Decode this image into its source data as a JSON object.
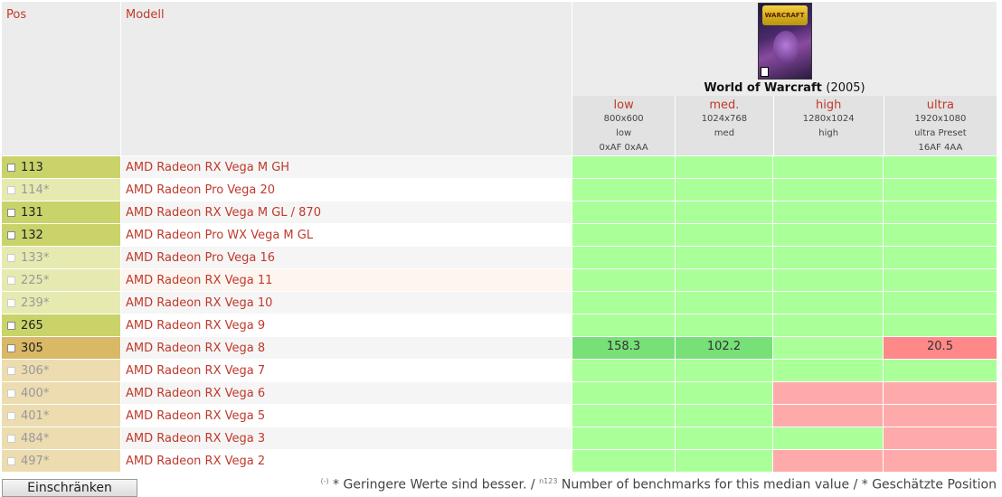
{
  "header": {
    "pos_label": "Pos",
    "model_label": "Modell",
    "game": {
      "name": "World of Warcraft",
      "year": "(2005)",
      "cover_logo": "WARCRAFT"
    },
    "settings": [
      {
        "level": "low",
        "res": "800x600",
        "preset": "low",
        "extra": "0xAF 0xAA",
        "width": 114
      },
      {
        "level": "med.",
        "res": "1024x768",
        "preset": "med",
        "extra": "",
        "width": 108
      },
      {
        "level": "high",
        "res": "1280x1024",
        "preset": "high",
        "extra": "",
        "width": 122
      },
      {
        "level": "ultra",
        "res": "1920x1080",
        "preset": "ultra Preset",
        "extra": "16AF 4AA",
        "width": 125
      }
    ]
  },
  "colors": {
    "pos_dark": "#c9d36a",
    "pos_light": "#e6eab0",
    "pos_gold": "#d9b866",
    "pos_gold_light": "#ecdcb0",
    "green": "#aaff99",
    "dark_green": "#77e077",
    "red": "#ffaaaa",
    "dark_red": "#ff8888",
    "row_alt": "#f5f5f5",
    "row_highlight": "#fdf5ef"
  },
  "rows": [
    {
      "pos": "113",
      "est": false,
      "model": "AMD Radeon RX Vega M GH",
      "cells": [
        "green",
        "green",
        "green",
        "green"
      ],
      "values": [
        "",
        "",
        "",
        ""
      ]
    },
    {
      "pos": "114*",
      "est": true,
      "model": "AMD Radeon Pro Vega 20",
      "cells": [
        "green",
        "green",
        "green",
        "green"
      ],
      "values": [
        "",
        "",
        "",
        ""
      ]
    },
    {
      "pos": "131",
      "est": false,
      "model": "AMD Radeon RX Vega M GL / 870",
      "cells": [
        "green",
        "green",
        "green",
        "green"
      ],
      "values": [
        "",
        "",
        "",
        ""
      ]
    },
    {
      "pos": "132",
      "est": false,
      "model": "AMD Radeon Pro WX Vega M GL",
      "cells": [
        "green",
        "green",
        "green",
        "green"
      ],
      "values": [
        "",
        "",
        "",
        ""
      ]
    },
    {
      "pos": "133*",
      "est": true,
      "model": "AMD Radeon Pro Vega 16",
      "cells": [
        "green",
        "green",
        "green",
        "green"
      ],
      "values": [
        "",
        "",
        "",
        ""
      ]
    },
    {
      "pos": "225*",
      "est": true,
      "model": "AMD Radeon RX Vega 11",
      "cells": [
        "green",
        "green",
        "green",
        "green"
      ],
      "values": [
        "",
        "",
        "",
        ""
      ]
    },
    {
      "pos": "239*",
      "est": true,
      "model": "AMD Radeon RX Vega 10",
      "cells": [
        "green",
        "green",
        "green",
        "green"
      ],
      "values": [
        "",
        "",
        "",
        ""
      ]
    },
    {
      "pos": "265",
      "est": false,
      "model": "AMD Radeon RX Vega 9",
      "cells": [
        "green",
        "green",
        "green",
        "green"
      ],
      "values": [
        "",
        "",
        "",
        ""
      ]
    },
    {
      "pos": "305",
      "est": false,
      "model": "AMD Radeon RX Vega 8",
      "cells": [
        "dgreen",
        "dgreen",
        "green",
        "dred"
      ],
      "values": [
        "158.3",
        "102.2",
        "",
        "20.5"
      ]
    },
    {
      "pos": "306*",
      "est": true,
      "model": "AMD Radeon RX Vega 7",
      "cells": [
        "green",
        "green",
        "green",
        "green"
      ],
      "values": [
        "",
        "",
        "",
        ""
      ]
    },
    {
      "pos": "400*",
      "est": true,
      "model": "AMD Radeon RX Vega 6",
      "cells": [
        "green",
        "green",
        "red",
        "red"
      ],
      "values": [
        "",
        "",
        "",
        ""
      ]
    },
    {
      "pos": "401*",
      "est": true,
      "model": "AMD Radeon RX Vega 5",
      "cells": [
        "green",
        "green",
        "red",
        "red"
      ],
      "values": [
        "",
        "",
        "",
        ""
      ]
    },
    {
      "pos": "484*",
      "est": true,
      "model": "AMD Radeon RX Vega 3",
      "cells": [
        "green",
        "green",
        "green",
        "red"
      ],
      "values": [
        "",
        "",
        "",
        ""
      ]
    },
    {
      "pos": "497*",
      "est": true,
      "model": "AMD Radeon RX Vega 2",
      "cells": [
        "green",
        "green",
        "red",
        "red"
      ],
      "values": [
        "",
        "",
        "",
        ""
      ]
    }
  ],
  "footer": {
    "button_label": "Einschränken",
    "note_sup1": "(-)",
    "note_text1": " * Geringere Werte sind besser. / ",
    "note_sup2": "n123",
    "note_text2": " Number of benchmarks for this median value / * Geschätzte Position"
  }
}
